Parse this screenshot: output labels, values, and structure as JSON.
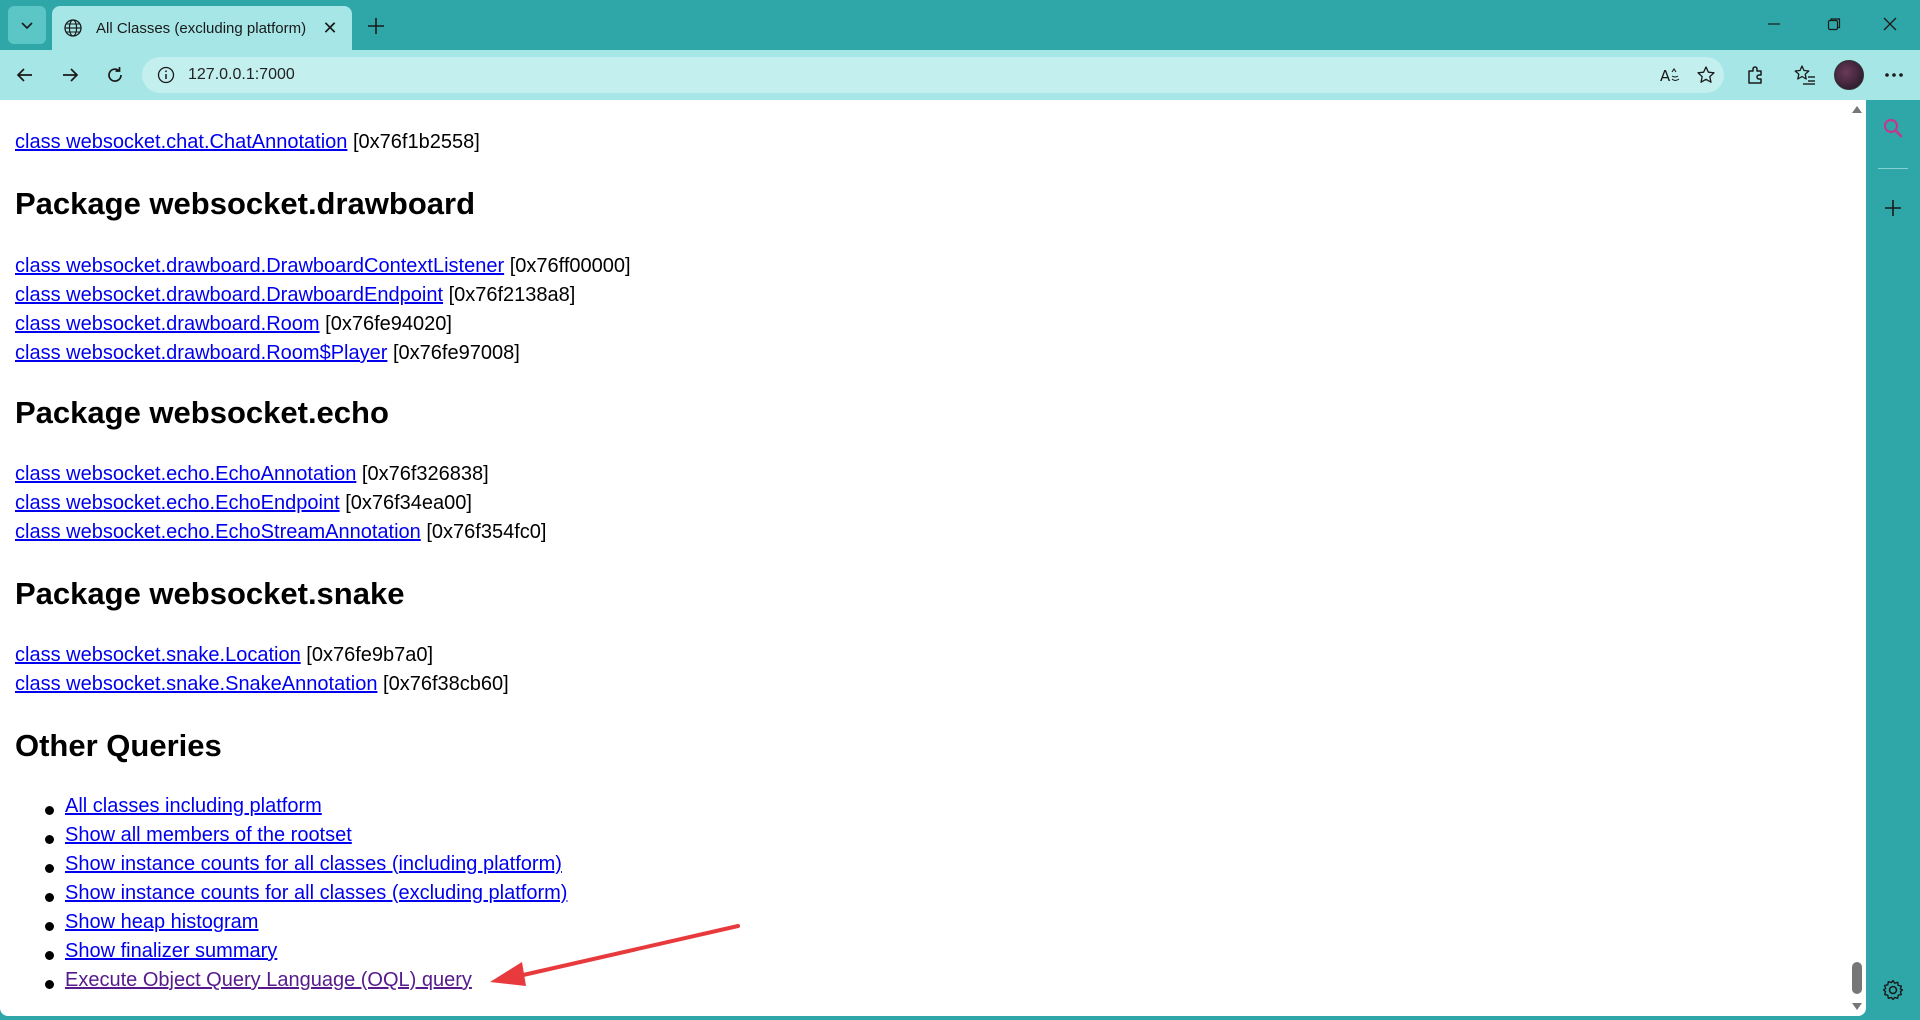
{
  "browser": {
    "tab_title": "All Classes (excluding platform)",
    "tab_close": "✕",
    "url": "127.0.0.1:7000",
    "read_aloud": "Â"
  },
  "page": {
    "top_row": {
      "link": "class websocket.chat.ChatAnnotation",
      "addr": "[0x76f1b2558]"
    },
    "sections": [
      {
        "title": "Package websocket.drawboard",
        "rows": [
          {
            "link": "class websocket.drawboard.DrawboardContextListener",
            "addr": "[0x76ff00000]"
          },
          {
            "link": "class websocket.drawboard.DrawboardEndpoint",
            "addr": "[0x76f2138a8]"
          },
          {
            "link": "class websocket.drawboard.Room",
            "addr": "[0x76fe94020]"
          },
          {
            "link": "class websocket.drawboard.Room$Player",
            "addr": "[0x76fe97008]"
          }
        ]
      },
      {
        "title": "Package websocket.echo",
        "rows": [
          {
            "link": "class websocket.echo.EchoAnnotation",
            "addr": "[0x76f326838]"
          },
          {
            "link": "class websocket.echo.EchoEndpoint",
            "addr": "[0x76f34ea00]"
          },
          {
            "link": "class websocket.echo.EchoStreamAnnotation",
            "addr": "[0x76f354fc0]"
          }
        ]
      },
      {
        "title": "Package websocket.snake",
        "rows": [
          {
            "link": "class websocket.snake.Location",
            "addr": "[0x76fe9b7a0]"
          },
          {
            "link": "class websocket.snake.SnakeAnnotation",
            "addr": "[0x76f38cb60]"
          }
        ]
      }
    ],
    "other_queries": {
      "title": "Other Queries",
      "items": [
        "All classes including platform",
        "Show all members of the rootset",
        "Show instance counts for all classes (including platform)",
        "Show instance counts for all classes (excluding platform)",
        "Show heap histogram",
        "Show finalizer summary",
        "Execute Object Query Language (OQL) query"
      ]
    }
  },
  "colors": {
    "link": "#0000ee",
    "visited_link": "#551a8b",
    "annotation_arrow": "#e8393d",
    "browser_frame": "#2fa7a8"
  }
}
